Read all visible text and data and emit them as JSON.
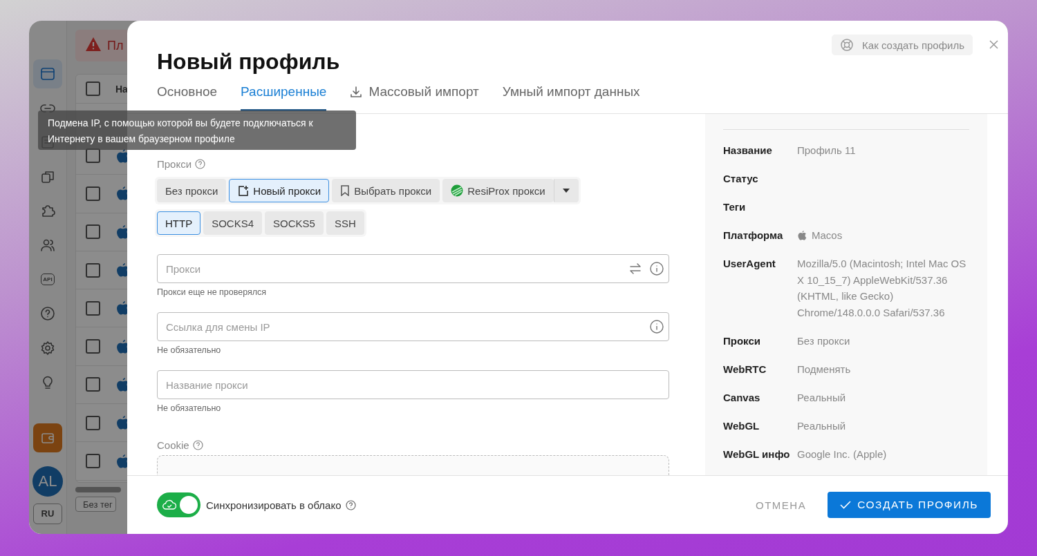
{
  "background_app": {
    "sidebar": [
      {
        "kind": "browser",
        "selected": true
      },
      {
        "kind": "link",
        "selected": false
      },
      {
        "kind": "list",
        "selected": false
      },
      {
        "kind": "copy",
        "selected": false
      },
      {
        "kind": "puzzle",
        "selected": false
      },
      {
        "kind": "users",
        "selected": false
      },
      {
        "kind": "api",
        "label": "API",
        "selected": false
      },
      {
        "kind": "help",
        "selected": false
      },
      {
        "kind": "settings",
        "selected": false
      },
      {
        "kind": "bulb",
        "selected": false
      },
      {
        "kind": "wallet",
        "selected": false
      }
    ],
    "avatar": "AL",
    "language": "RU",
    "banner": "Пл",
    "table_header": "На",
    "header_checked": false,
    "rows": [
      {
        "checked": false
      },
      {
        "checked": false
      },
      {
        "checked": false
      },
      {
        "checked": false
      },
      {
        "checked": false
      },
      {
        "checked": false
      },
      {
        "checked": false
      },
      {
        "checked": false
      },
      {
        "checked": false
      }
    ],
    "tag_filter": "Без тег"
  },
  "modal": {
    "title": "Новый профиль",
    "help_button": "Как создать профиль",
    "tabs": [
      {
        "label": "Основное",
        "selected": false,
        "kind": "plain"
      },
      {
        "label": "Расширенные",
        "selected": true,
        "kind": "plain"
      },
      {
        "label": "Массовый импорт",
        "selected": false,
        "kind": "download"
      },
      {
        "label": "Умный импорт данных",
        "selected": false,
        "kind": "plain"
      }
    ],
    "tooltip": "Подмена IP, с помощью которой вы будете подключаться к Интернету в вашем браузерном профиле",
    "proxy_label": "Прокси",
    "proxy_sources": [
      {
        "label": "Без прокси",
        "selected": false,
        "kind": "plain"
      },
      {
        "label": "Новый прокси",
        "selected": true,
        "kind": "new"
      },
      {
        "label": "Выбрать прокси",
        "selected": false,
        "kind": "bookmark"
      },
      {
        "label": "ResiProx прокси",
        "selected": false,
        "kind": "resiprox"
      }
    ],
    "protocols": [
      {
        "label": "HTTP",
        "selected": true
      },
      {
        "label": "SOCKS4",
        "selected": false
      },
      {
        "label": "SOCKS5",
        "selected": false
      },
      {
        "label": "SSH",
        "selected": false
      }
    ],
    "fields": [
      {
        "kind": "proxy",
        "placeholder": "Прокси",
        "helper": "Прокси еще не проверялся"
      },
      {
        "kind": "link",
        "placeholder": "Ссылка для смены IP",
        "helper": "Не обязательно"
      },
      {
        "kind": "name",
        "placeholder": "Название прокси",
        "helper": "Не обязательно"
      }
    ],
    "cookie_label": "Cookie",
    "summary": [
      {
        "label": "Название",
        "value": "Профиль 11"
      },
      {
        "label": "Статус"
      },
      {
        "label": "Теги"
      },
      {
        "label": "Платформа",
        "value": "Macos",
        "kind": "platform"
      },
      {
        "label": "UserAgent",
        "value": "Mozilla/5.0 (Macintosh; Intel Mac OS X 10_15_7) AppleWebKit/537.36 (KHTML, like Gecko) Chrome/148.0.0.0 Safari/537.36"
      },
      {
        "label": "Прокси",
        "value": "Без прокси"
      },
      {
        "label": "WebRTC",
        "value": "Подменять"
      },
      {
        "label": "Canvas",
        "value": "Реальный"
      },
      {
        "label": "WebGL",
        "value": "Реальный"
      },
      {
        "label": "WebGL инфо",
        "value": "Google Inc. (Apple)"
      }
    ],
    "sync": {
      "label": "Синхронизировать в облако",
      "on": true
    },
    "cancel": "ОТМЕНА",
    "create": "СОЗДАТЬ ПРОФИЛЬ"
  }
}
